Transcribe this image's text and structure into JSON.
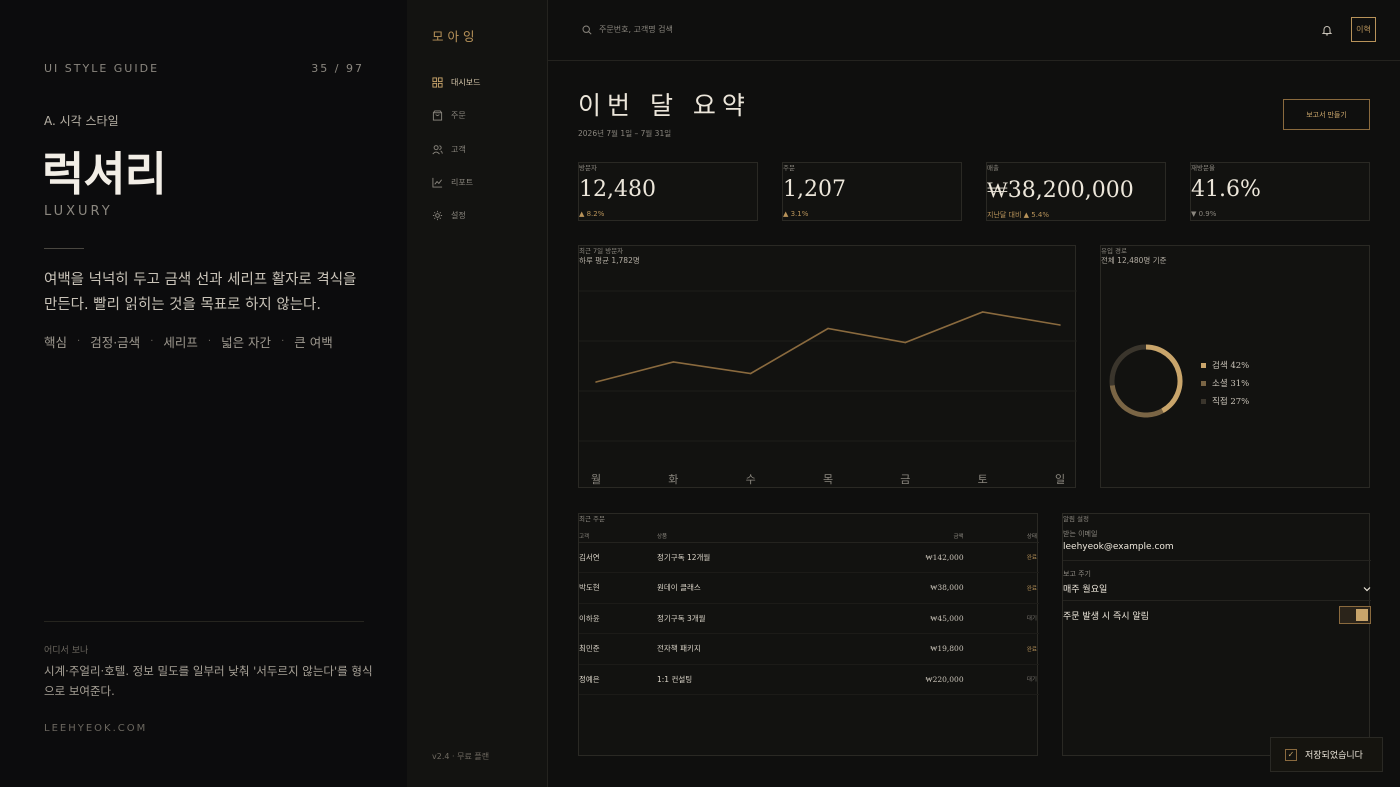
{
  "guide": {
    "header_left": "UI STYLE GUIDE",
    "page_counter": "35 / 97",
    "section": "A. 시각 스타일",
    "title": "럭셔리",
    "subtitle": "LUXURY",
    "description": "여백을 넉넉히 두고 금색 선과 세리프 활자로 격식을 만든다. 빨리 읽히는 것을 목표로 하지 않는다.",
    "tags": [
      "핵심",
      "검정·금색",
      "세리프",
      "넓은 자간",
      "큰 여백"
    ],
    "tag_separator": "·",
    "where_label": "어디서 보나",
    "where_desc": "시계·주얼리·호텔. 정보 밀도를 일부러 낮춰 '서두르지 않는다'를 형식으로 보여준다.",
    "site": "LEEHYEOK.COM"
  },
  "app": {
    "brand": "모아잉",
    "nav": [
      {
        "label": "대시보드",
        "icon": "grid-icon",
        "active": true
      },
      {
        "label": "주문",
        "icon": "bag-icon",
        "active": false
      },
      {
        "label": "고객",
        "icon": "users-icon",
        "active": false
      },
      {
        "label": "리포트",
        "icon": "chart-icon",
        "active": false
      },
      {
        "label": "설정",
        "icon": "settings-icon",
        "active": false
      }
    ],
    "version": "v2.4 · 무료 플랜",
    "search_placeholder": "주문번호, 고객명 검색",
    "avatar_text": "이혁",
    "page_title": "이번 달 요약",
    "date_range": "2026년 7월 1일 – 7월 31일",
    "report_button": "보고서 만들기",
    "kpis": [
      {
        "label": "방문자",
        "value": "12,480",
        "delta": "▲ 8.2%",
        "direction": "up"
      },
      {
        "label": "주문",
        "value": "1,207",
        "delta": "▲ 3.1%",
        "direction": "up"
      },
      {
        "label": "매출",
        "value": "₩38,200,000",
        "delta": "지난달 대비 ▲ 5.4%",
        "direction": "up"
      },
      {
        "label": "재방문율",
        "value": "41.6%",
        "delta": "▼ 0.9%",
        "direction": "down"
      }
    ],
    "visits_card": {
      "label": "최근 7일 방문자",
      "sub": "하루 평균 1,782명"
    },
    "source_card": {
      "label": "유입 경로",
      "sub": "전체 12,480명 기준"
    },
    "orders_card": {
      "label": "최근 주문",
      "columns": [
        "고객",
        "상품",
        "금액",
        "상태"
      ],
      "rows": [
        {
          "customer": "김서연",
          "product": "정기구독 12개월",
          "amount": "₩142,000",
          "status": "완료",
          "done": true
        },
        {
          "customer": "박도현",
          "product": "원데이 클래스",
          "amount": "₩38,000",
          "status": "완료",
          "done": true
        },
        {
          "customer": "이하윤",
          "product": "정기구독 3개월",
          "amount": "₩45,000",
          "status": "대기",
          "done": false
        },
        {
          "customer": "최민준",
          "product": "전자책 패키지",
          "amount": "₩19,800",
          "status": "완료",
          "done": true
        },
        {
          "customer": "정예은",
          "product": "1:1 컨설팅",
          "amount": "₩220,000",
          "status": "대기",
          "done": false
        }
      ]
    },
    "settings_card": {
      "label": "알림 설정",
      "email_label": "받는 이메일",
      "email_value": "leehyeok@example.com",
      "cycle_label": "보고 주기",
      "cycle_value": "매주 월요일",
      "toggle_label": "주문 발생 시 즉시 알림",
      "toggle_on": true
    },
    "toast": "저장되었습니다"
  },
  "colors": {
    "gold": "#b8935a",
    "gold_light": "#c9a56b",
    "background": "#0f0f0e",
    "text": "#ece6da"
  },
  "chart_data": [
    {
      "type": "line",
      "title": "최근 7일 방문자",
      "subtitle": "하루 평균 1,782명",
      "categories": [
        "월",
        "화",
        "수",
        "목",
        "금",
        "토",
        "일"
      ],
      "values": [
        1180,
        1580,
        1350,
        2250,
        1970,
        2580,
        2320
      ],
      "ylim": [
        0,
        3000
      ],
      "grid": true
    },
    {
      "type": "pie",
      "title": "유입 경로",
      "subtitle": "전체 12,480명 기준",
      "slices": [
        {
          "label": "검색 42%",
          "value": 42,
          "color": "#c9a56b"
        },
        {
          "label": "소셜 31%",
          "value": 31,
          "color": "#7a6545"
        },
        {
          "label": "직접 27%",
          "value": 27,
          "color": "#3a352c"
        }
      ],
      "legend": "right"
    }
  ]
}
